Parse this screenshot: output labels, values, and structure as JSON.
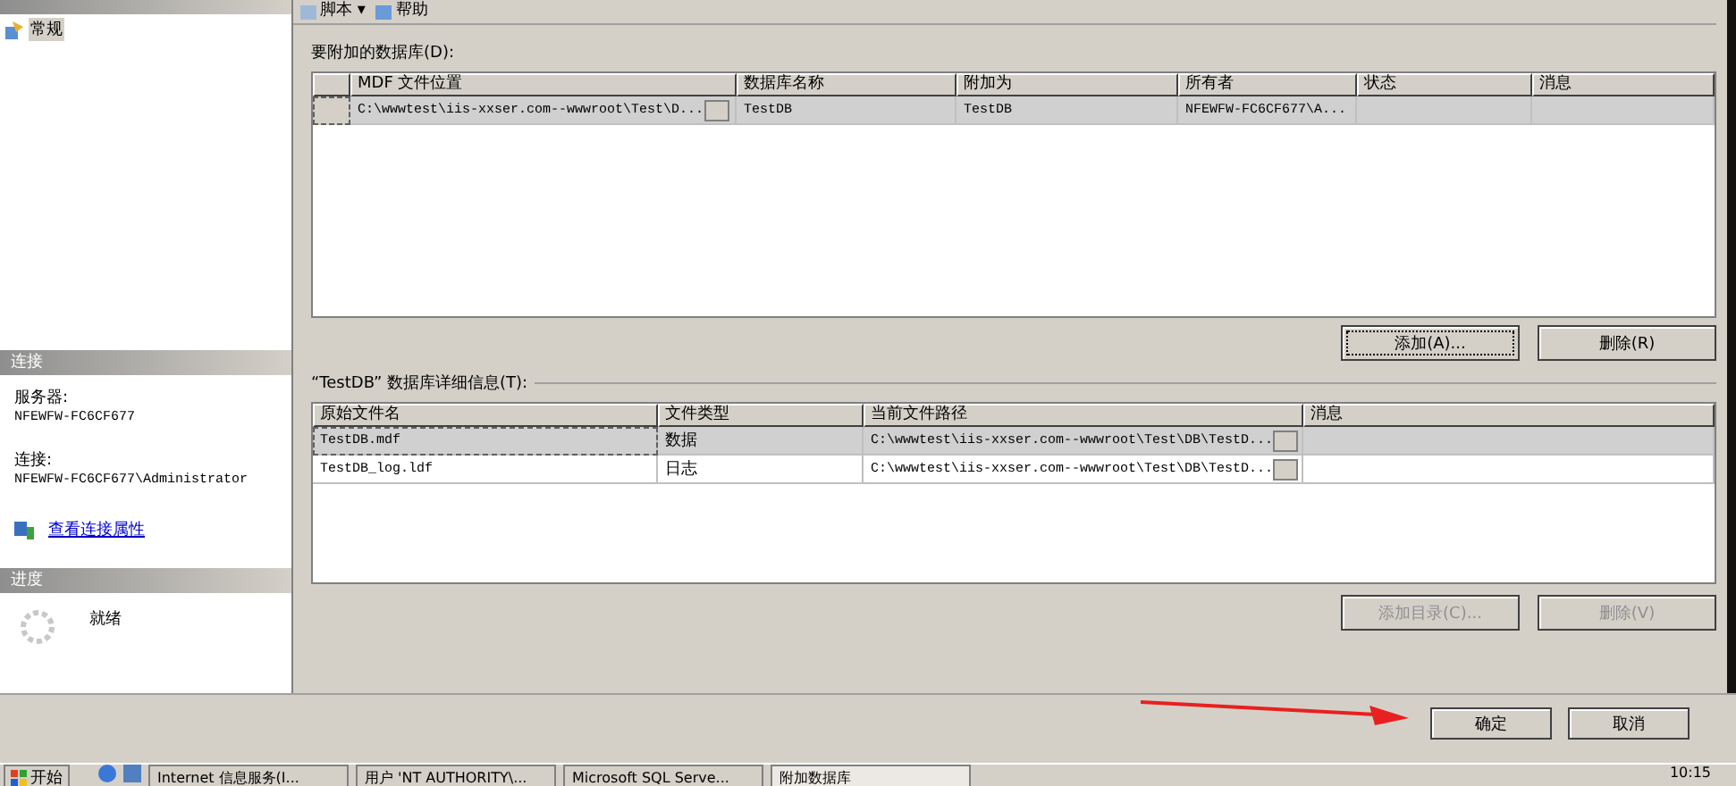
{
  "toolbar": {
    "items": [
      {
        "label": "脚本 ▾"
      },
      {
        "label": "帮助"
      }
    ]
  },
  "sidebar": {
    "pages": [
      {
        "label": "常规",
        "selected": true
      }
    ],
    "connection_header": "连接",
    "server_label": "服务器:",
    "server": "NFEWFW-FC6CF677",
    "connection_label": "连接:",
    "connection": "NFEWFW-FC6CF677\\Administrator",
    "link": "查看连接属性",
    "progress_header": "进度",
    "progress_status": "就绪"
  },
  "databases": {
    "label": "要附加的数据库(D):",
    "columns": [
      "MDF 文件位置",
      "数据库名称",
      "附加为",
      "所有者",
      "状态",
      "消息"
    ],
    "rows": [
      {
        "cells": [
          "C:\\wwwtest\\iis-xxser.com--wwwroot\\Test\\D...",
          "TestDB",
          "TestDB",
          "NFEWFW-FC6CF677\\A...",
          "",
          ""
        ],
        "selected": true
      }
    ],
    "buttons": [
      {
        "label": "添加(A)...",
        "disabled": false,
        "focused": true
      },
      {
        "label": "删除(R)",
        "disabled": false,
        "focused": false
      }
    ]
  },
  "details": {
    "label": "“TestDB” 数据库详细信息(T):",
    "columns": [
      "原始文件名",
      "文件类型",
      "当前文件路径",
      "消息"
    ],
    "rows": [
      {
        "cells": [
          "TestDB.mdf",
          "数据",
          "C:\\wwwtest\\iis-xxser.com--wwwroot\\Test\\DB\\TestD...",
          ""
        ],
        "selected": true
      },
      {
        "cells": [
          "TestDB_log.ldf",
          "日志",
          "C:\\wwwtest\\iis-xxser.com--wwwroot\\Test\\DB\\TestD...",
          ""
        ],
        "selected": false
      }
    ],
    "buttons": [
      {
        "label": "添加目录(C)...",
        "disabled": true,
        "focused": false
      },
      {
        "label": "删除(V)",
        "disabled": true,
        "focused": false
      }
    ]
  },
  "footer": {
    "buttons": [
      {
        "label": "确定"
      },
      {
        "label": "取消"
      }
    ]
  },
  "taskbar": {
    "start": "开始",
    "tasks": [
      {
        "label": "Internet 信息服务(I...",
        "selected": false
      },
      {
        "label": "用户 'NT AUTHORITY\\...",
        "selected": false
      },
      {
        "label": "Microsoft SQL Serve...",
        "selected": false
      },
      {
        "label": "附加数据库",
        "selected": true
      }
    ],
    "clock": "10:15"
  }
}
